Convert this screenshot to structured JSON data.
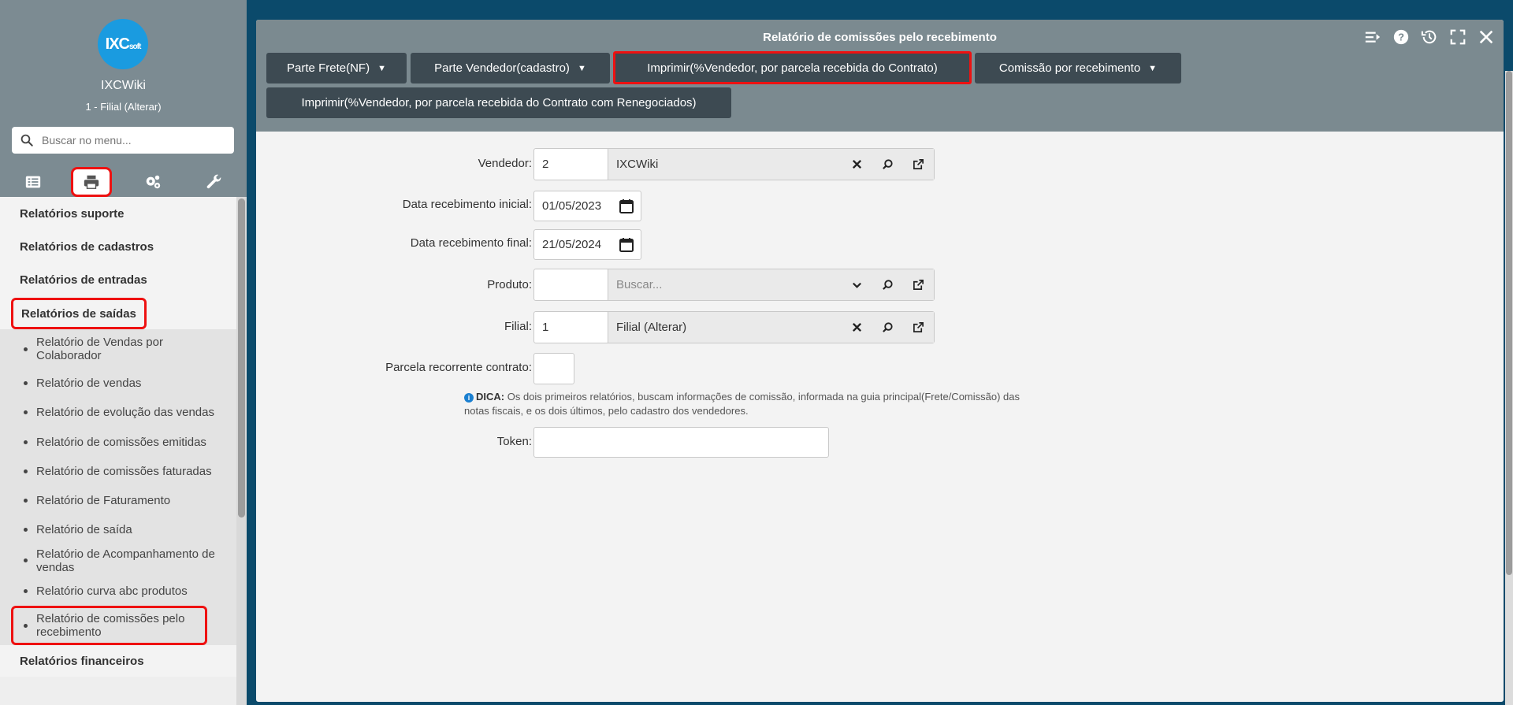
{
  "sidebar": {
    "logo_text": "IXC",
    "logo_sub": "soft",
    "brand_name": "IXCWiki",
    "branch": "1 - Filial (Alterar)",
    "search_placeholder": "Buscar no menu...",
    "tabs": [
      "list-icon",
      "printer-icon",
      "gears-icon",
      "wrench-icon"
    ],
    "active_tab": "printer-icon",
    "menu": [
      {
        "label": "Relatórios suporte"
      },
      {
        "label": "Relatórios de cadastros"
      },
      {
        "label": "Relatórios de entradas"
      },
      {
        "label": "Relatórios de saídas"
      },
      {
        "label": "Relatórios financeiros"
      }
    ],
    "sub_items": [
      "Relatório de Vendas por Colaborador",
      "Relatório de vendas",
      "Relatório de evolução das vendas",
      "Relatório de comissões emitidas",
      "Relatório de comissões faturadas",
      "Relatório de Faturamento",
      "Relatório de saída",
      "Relatório de Acompanhamento de vendas",
      "Relatório curva abc produtos",
      "Relatório de comissões pelo recebimento"
    ]
  },
  "window": {
    "title": "Relatório de comissões pelo recebimento",
    "tools": [
      "collapse-menu-icon",
      "help-icon",
      "history-icon",
      "fullscreen-icon",
      "close-icon"
    ],
    "buttons": {
      "parte_frete": "Parte Frete(NF)",
      "parte_vendedor": "Parte Vendedor(cadastro)",
      "imprimir_contrato": "Imprimir(%Vendedor, por parcela recebida do Contrato)",
      "comissao_recebimento": "Comissão por recebimento",
      "imprimir_renegociados": "Imprimir(%Vendedor, por parcela recebida do Contrato com Renegociados)"
    }
  },
  "form": {
    "vendedor": {
      "label": "Vendedor:",
      "code": "2",
      "desc": "IXCWiki"
    },
    "data_inicial": {
      "label": "Data recebimento inicial:",
      "value": "01/05/2023"
    },
    "data_final": {
      "label": "Data recebimento final:",
      "value": "21/05/2024"
    },
    "produto": {
      "label": "Produto:",
      "code": "",
      "placeholder": "Buscar..."
    },
    "filial": {
      "label": "Filial:",
      "code": "1",
      "desc": "Filial (Alterar)"
    },
    "parcela": {
      "label": "Parcela recorrente contrato:"
    },
    "tip_title": "DICA:",
    "tip_text": "Os dois primeiros relatórios, buscam informações de comissão, informada na guia principal(Frete/Comissão) das notas fiscais, e os dois últimos, pelo cadastro dos vendedores.",
    "token": {
      "label": "Token:",
      "value": ""
    }
  },
  "colors": {
    "accent": "#1a9be0",
    "highlight": "#e11111",
    "header": "#7b8a90",
    "button": "#3d4a52"
  }
}
